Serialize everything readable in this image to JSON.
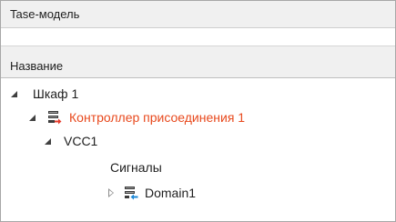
{
  "window": {
    "title": "Tase-модель"
  },
  "table": {
    "column_header": "Название"
  },
  "tree": {
    "items": [
      {
        "label": "Шкаф 1",
        "state": "expanded"
      },
      {
        "label": "Контроллер присоединения 1",
        "state": "expanded",
        "icon": "controller-red-arrow-icon",
        "color": "#e8491d"
      },
      {
        "label": "VCC1",
        "state": "expanded"
      },
      {
        "label": "Сигналы",
        "state": "leaf"
      },
      {
        "label": "Domain1",
        "state": "collapsed",
        "icon": "domain-blue-arrow-icon"
      }
    ]
  },
  "colors": {
    "highlight_text": "#e8491d",
    "header_bg": "#f0f0f0",
    "border": "#a7a7a7"
  }
}
